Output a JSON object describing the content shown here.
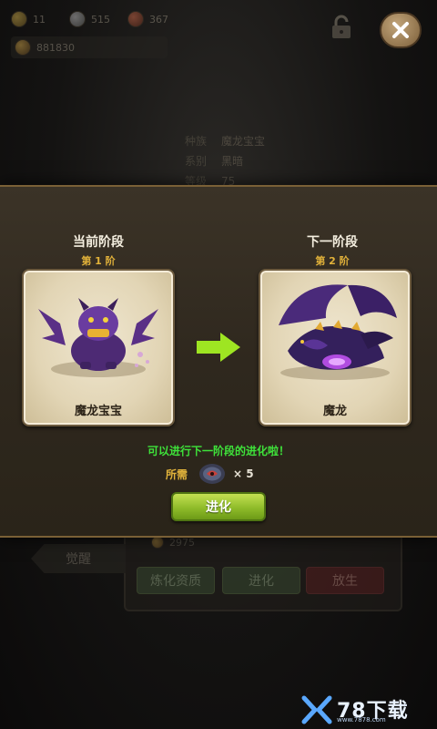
{
  "background": {
    "currencies": [
      {
        "name": "gold",
        "value": "11"
      },
      {
        "name": "silver",
        "value": "515"
      },
      {
        "name": "gem",
        "value": "367"
      }
    ],
    "power": "881830",
    "info": [
      {
        "key": "种族",
        "value": "魔龙宝宝"
      },
      {
        "key": "系别",
        "value": "黑暗"
      },
      {
        "key": "等级",
        "value": "75"
      }
    ],
    "power_bottom": "2975",
    "awaken_tab": "觉醒",
    "buttons": {
      "refine": "炼化资质",
      "evolve": "进化",
      "release": "放生"
    }
  },
  "modal": {
    "current": {
      "title": "当前阶段",
      "stage": "第 1 阶",
      "pet_name": "魔龙宝宝"
    },
    "next": {
      "title": "下一阶段",
      "stage": "第 2 阶",
      "pet_name": "魔龙"
    },
    "hint": "可以进行下一阶段的进化啦！",
    "require_label": "所需",
    "require_count": "× 5",
    "evolve_button": "进化"
  },
  "watermark": {
    "brand": "78下载",
    "url": "www.7878.com"
  },
  "colors": {
    "accent_green": "#3ee23a",
    "stage_gold": "#e2b23a",
    "button_green": "#8fbc2a",
    "release_red": "#5a2424"
  }
}
